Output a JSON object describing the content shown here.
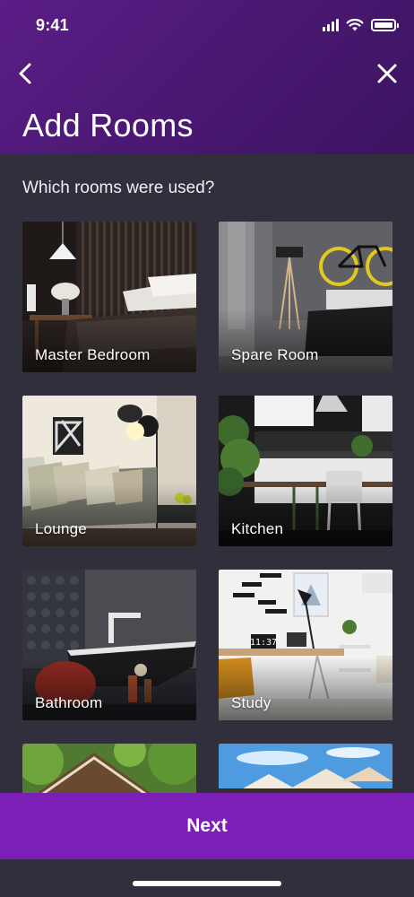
{
  "status_bar": {
    "time": "9:41"
  },
  "header": {
    "title": "Add Rooms"
  },
  "question": "Which rooms were used?",
  "rooms": [
    {
      "label": "Master Bedroom"
    },
    {
      "label": "Spare Room"
    },
    {
      "label": "Lounge"
    },
    {
      "label": "Kitchen"
    },
    {
      "label": "Bathroom"
    },
    {
      "label": "Study"
    },
    {
      "label": ""
    },
    {
      "label": ""
    }
  ],
  "study_clock": "11:37",
  "footer": {
    "next_label": "Next"
  },
  "colors": {
    "header": "#4b1873",
    "background": "#312f3c",
    "primary_button": "#7b1fb7"
  }
}
